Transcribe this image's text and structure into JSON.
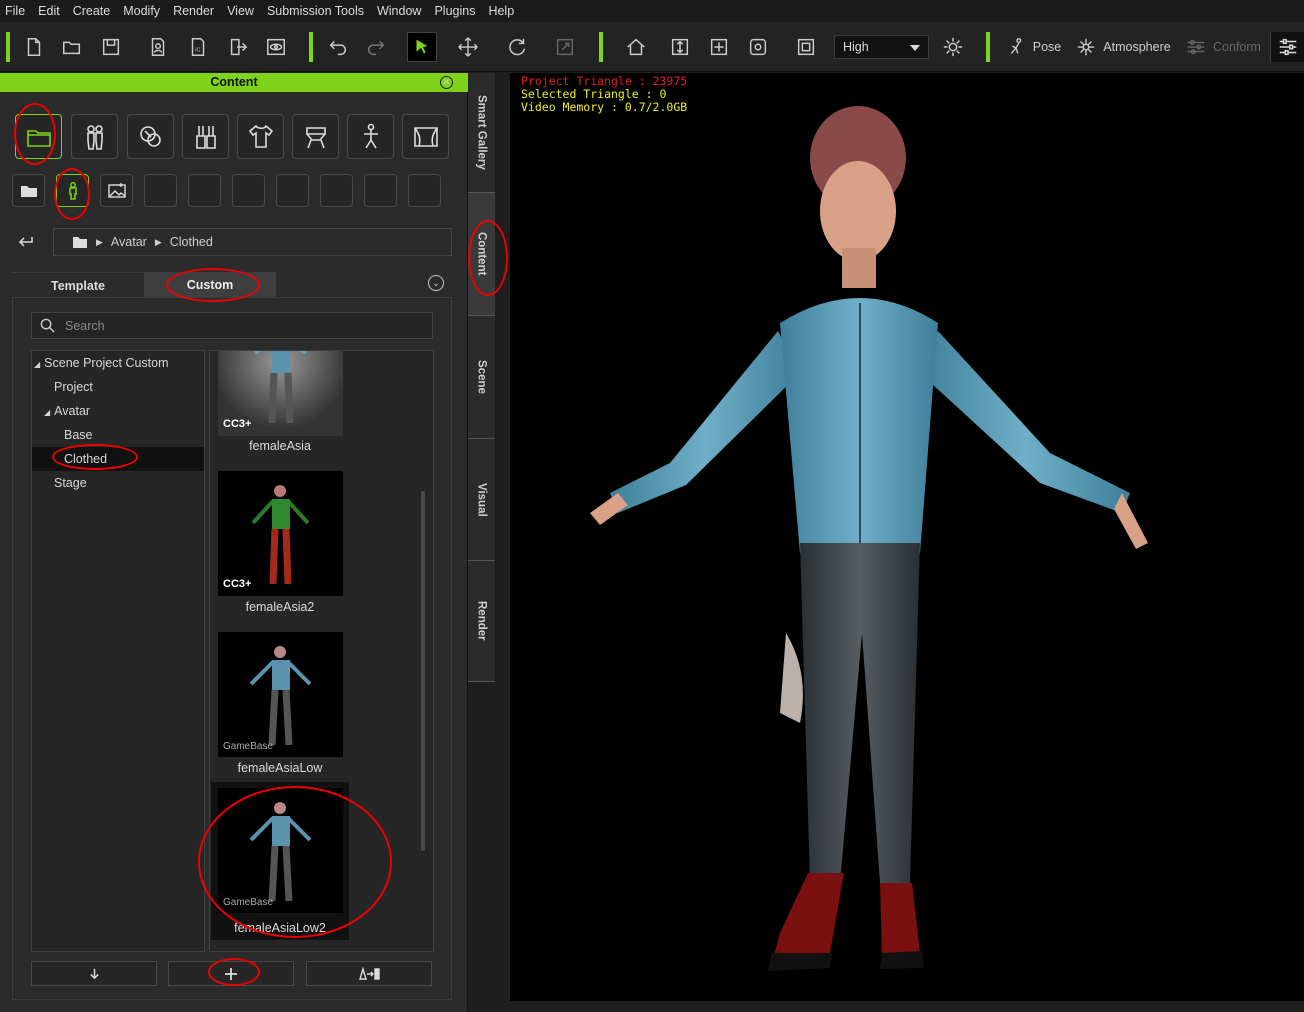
{
  "menu": [
    "File",
    "Edit",
    "Create",
    "Modify",
    "Render",
    "View",
    "Submission Tools",
    "Window",
    "Plugins",
    "Help"
  ],
  "toolbar": {
    "quality": "High",
    "pose": "Pose",
    "atmosphere": "Atmosphere",
    "conform": "Conform"
  },
  "panel": {
    "title": "Content",
    "breadcrumb": [
      "Avatar",
      "Clothed"
    ],
    "tabs": {
      "template": "Template",
      "custom": "Custom"
    },
    "search_placeholder": "Search",
    "tree": [
      {
        "label": "Scene Project Custom"
      },
      {
        "label": "Project"
      },
      {
        "label": "Avatar"
      },
      {
        "label": "Base"
      },
      {
        "label": "Clothed"
      },
      {
        "label": "Stage"
      }
    ],
    "items": [
      {
        "label": "femaleAsia",
        "badge": "CC3+"
      },
      {
        "label": "femaleAsia2",
        "badge": "CC3+"
      },
      {
        "label": "femaleAsiaLow",
        "badge": "GameBase"
      },
      {
        "label": "femaleAsiaLow2",
        "badge": "GameBase"
      }
    ]
  },
  "side_tabs": [
    "Smart Gallery",
    "Content",
    "Scene",
    "Visual",
    "Render"
  ],
  "viewport": {
    "project_triangle": "Project Triangle : 23975",
    "selected_triangle": "Selected Triangle : 0",
    "video_memory": "Video Memory : 0.7/2.0GB"
  },
  "colors": {
    "accent": "#7fd31c",
    "annotation": "#e00000"
  }
}
